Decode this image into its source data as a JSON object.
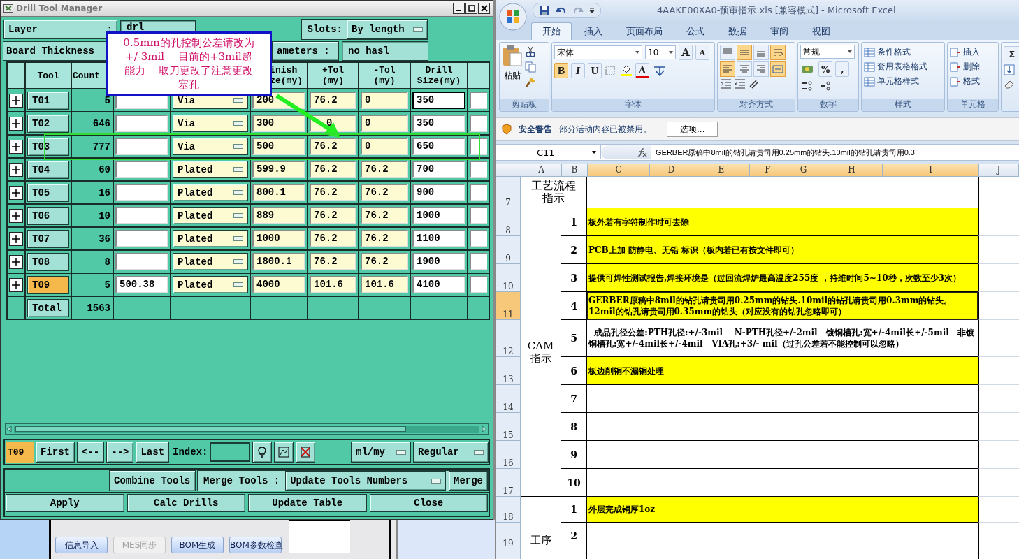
{
  "drill_window": {
    "title": "Drill Tool Manager",
    "layer": {
      "label": "Layer",
      "colon": ":",
      "value": "drl"
    },
    "slots": {
      "label": "Slots:",
      "value": "By length"
    },
    "board_thickness": {
      "label": "Board Thickness"
    },
    "parameters": {
      "label": "ameters :",
      "value": "no_hasl"
    },
    "columns": {
      "tool": "Tool",
      "count": "Count",
      "finish": "inish\nze(my)",
      "plus_tol": "+Tol\n(my)",
      "minus_tol": "-Tol\n(my)",
      "drill": "Drill\nSize(my)"
    },
    "rows": [
      {
        "tool": "T01",
        "count": "5",
        "type": "Via",
        "finish": "200",
        "plus_tol": "76.2",
        "minus_tol": "0",
        "drill": "350",
        "selected": false
      },
      {
        "tool": "T02",
        "count": "646",
        "type": "Via",
        "finish": "300",
        "plus_tol": "0",
        "minus_tol": "0",
        "drill": "350",
        "selected": false
      },
      {
        "tool": "T03",
        "count": "777",
        "type": "Via",
        "finish": "500",
        "plus_tol": "76.2",
        "minus_tol": "0",
        "drill": "650",
        "selected": false
      },
      {
        "tool": "T04",
        "count": "60",
        "type": "Plated",
        "finish": "599.9",
        "plus_tol": "76.2",
        "minus_tol": "76.2",
        "drill": "700",
        "selected": false
      },
      {
        "tool": "T05",
        "count": "16",
        "type": "Plated",
        "finish": "800.1",
        "plus_tol": "76.2",
        "minus_tol": "76.2",
        "drill": "900",
        "selected": false
      },
      {
        "tool": "T06",
        "count": "10",
        "type": "Plated",
        "finish": "889",
        "plus_tol": "76.2",
        "minus_tol": "76.2",
        "drill": "1000",
        "selected": false
      },
      {
        "tool": "T07",
        "count": "36",
        "type": "Plated",
        "finish": "1000",
        "plus_tol": "76.2",
        "minus_tol": "76.2",
        "drill": "1100",
        "selected": false
      },
      {
        "tool": "T08",
        "count": "8",
        "type": "Plated",
        "finish": "1800.1",
        "plus_tol": "76.2",
        "minus_tol": "76.2",
        "drill": "1900",
        "selected": false
      },
      {
        "tool": "T09",
        "count": "5",
        "size": "500.38",
        "type": "Plated",
        "finish": "4000",
        "plus_tol": "101.6",
        "minus_tol": "101.6",
        "drill": "4100",
        "selected": true
      }
    ],
    "total": {
      "label": "Total",
      "count": "1563"
    },
    "nav": {
      "current": "T09",
      "buttons": [
        "First",
        "<--",
        "-->",
        "Last"
      ],
      "index_label": "Index:",
      "units": "ml/my",
      "mode": "Regular"
    },
    "merge": {
      "combine": "Combine Tools",
      "label": "Merge Tools :",
      "mode": "Update Tools Numbers",
      "button": "Merge"
    },
    "actions": [
      "Apply",
      "Calc Drills",
      "Update Table",
      "Close"
    ],
    "callout": {
      "text": "0.5mm的孔控制公差请改为+/-3mil　 目前的+3mil超能力　 取刀更改了注意更改塞孔"
    }
  },
  "background_app": {
    "buttons": [
      {
        "label": "信息导入",
        "disabled": false
      },
      {
        "label": "MES同步",
        "disabled": true
      },
      {
        "label": "BOM生成",
        "disabled": false
      },
      {
        "label": "BOM参数检查",
        "disabled": false
      }
    ]
  },
  "excel": {
    "title": "4AAKE00XA0-预审指示.xls  [兼容模式] - Microsoft Excel",
    "tabs": [
      {
        "label": "开始",
        "selected": true
      },
      {
        "label": "插入",
        "selected": false
      },
      {
        "label": "页面布局",
        "selected": false
      },
      {
        "label": "公式",
        "selected": false
      },
      {
        "label": "数据",
        "selected": false
      },
      {
        "label": "审阅",
        "selected": false
      },
      {
        "label": "视图",
        "selected": false
      }
    ],
    "ribbon": {
      "clipboard": {
        "paste": "粘贴",
        "group": "剪贴板"
      },
      "font": {
        "name": "宋体",
        "size": "10",
        "grow": "A",
        "shrink": "A",
        "styles": [
          {
            "label": "B",
            "selected": true
          },
          {
            "label": "I",
            "selected": false
          },
          {
            "label": "U",
            "selected": false
          }
        ],
        "color_label": "A",
        "group": "字体"
      },
      "alignment": {
        "buttons": [
          {
            "kind": "top",
            "selected": false
          },
          {
            "kind": "middle",
            "selected": true
          },
          {
            "kind": "bottom",
            "selected": false
          },
          {
            "kind": "wrap",
            "selected": true
          },
          {
            "kind": "left",
            "selected": true
          },
          {
            "kind": "center",
            "selected": false
          },
          {
            "kind": "right",
            "selected": false
          },
          {
            "kind": "merge",
            "selected": true
          }
        ],
        "group": "对齐方式"
      },
      "number": {
        "format": "常规",
        "percent": "%",
        "comma": ",",
        "group": "数字"
      },
      "styles": {
        "items": [
          "条件格式",
          "套用表格格式",
          "单元格样式"
        ],
        "group": "样式"
      },
      "cells": {
        "items": [
          "插入",
          "删除",
          "格式"
        ],
        "group": "单元格"
      },
      "editing": {
        "sum": "Σ"
      }
    },
    "security": {
      "title": "安全警告",
      "message": "部分活动内容已被禁用。",
      "button": "选项..."
    },
    "formula_bar": {
      "cell": "C11",
      "formula": "GERBER原稿中8mil的钻孔请贵司用0.25mm的钻头.10mil的钻孔请贵司用0.3"
    },
    "columns": [
      {
        "label": "A",
        "selected": false
      },
      {
        "label": "B",
        "selected": false
      },
      {
        "label": "C",
        "selected": true
      },
      {
        "label": "D",
        "selected": true
      },
      {
        "label": "E",
        "selected": true
      },
      {
        "label": "F",
        "selected": true
      },
      {
        "label": "G",
        "selected": true
      },
      {
        "label": "H",
        "selected": true
      },
      {
        "label": "I",
        "selected": true
      },
      {
        "label": "J",
        "selected": false
      }
    ],
    "rows": [
      {
        "label": "7",
        "selected": false
      },
      {
        "label": "8",
        "selected": false
      },
      {
        "label": "9",
        "selected": false
      },
      {
        "label": "10",
        "selected": false
      },
      {
        "label": "11",
        "selected": true
      },
      {
        "label": "12",
        "selected": false
      },
      {
        "label": "13",
        "selected": false
      },
      {
        "label": "14",
        "selected": false
      },
      {
        "label": "15",
        "selected": false
      },
      {
        "label": "16",
        "selected": false
      },
      {
        "label": "17",
        "selected": false
      },
      {
        "label": "18",
        "selected": false
      },
      {
        "label": "19",
        "selected": false
      }
    ],
    "sections": [
      {
        "kind": "header",
        "title": "工艺流程指示"
      },
      {
        "kind": "list",
        "title": "CAM指示",
        "items": [
          {
            "no": "1",
            "text": "板外若有字符制作时可去除",
            "highlight": true,
            "selected": false
          },
          {
            "no": "2",
            "text": "PCB上加 防静电、无铅 标识（板内若已有按文件即可）",
            "highlight": true,
            "selected": false
          },
          {
            "no": "3",
            "text": "提供可焊性测试报告,焊接环境是（过回流焊炉最高温度255度 ，持维时间5~10秒，次数至少3次）",
            "highlight": true,
            "selected": false
          },
          {
            "no": "4",
            "text": "GERBER原稿中8mil的钻孔请贵司用0.25mm的钻头.10mil的钻孔请贵司用0.3mm的钻头。12mil的钻孔请贵司用0.35mm的钻头（对应没有的钻孔忽略即可）",
            "highlight": true,
            "selected": true
          },
          {
            "no": "5",
            "text": "  成品孔径公差:PTH孔径:+/-3mil    N-PTH孔径+/-2mil   镀铜槽孔:宽+/-4mil长+/-5mil   非镀铜槽孔:宽+/-4mil长+/-4mil   VIA孔:+3/- mil（过孔公差若不能控制可以忽略）",
            "highlight": false,
            "selected": false
          },
          {
            "no": "6",
            "text": "板边削铜不漏铜处理",
            "highlight": true,
            "selected": false
          },
          {
            "no": "7",
            "highlight": false,
            "selected": false
          },
          {
            "no": "8",
            "highlight": false,
            "selected": false
          },
          {
            "no": "9",
            "highlight": false,
            "selected": false
          },
          {
            "no": "10",
            "highlight": false,
            "selected": false
          }
        ]
      },
      {
        "kind": "list",
        "title": "工序",
        "items": [
          {
            "no": "1",
            "text": "外层完成铜厚1oz",
            "highlight": true,
            "selected": false
          },
          {
            "no": "2",
            "highlight": false,
            "selected": false
          }
        ]
      }
    ]
  }
}
